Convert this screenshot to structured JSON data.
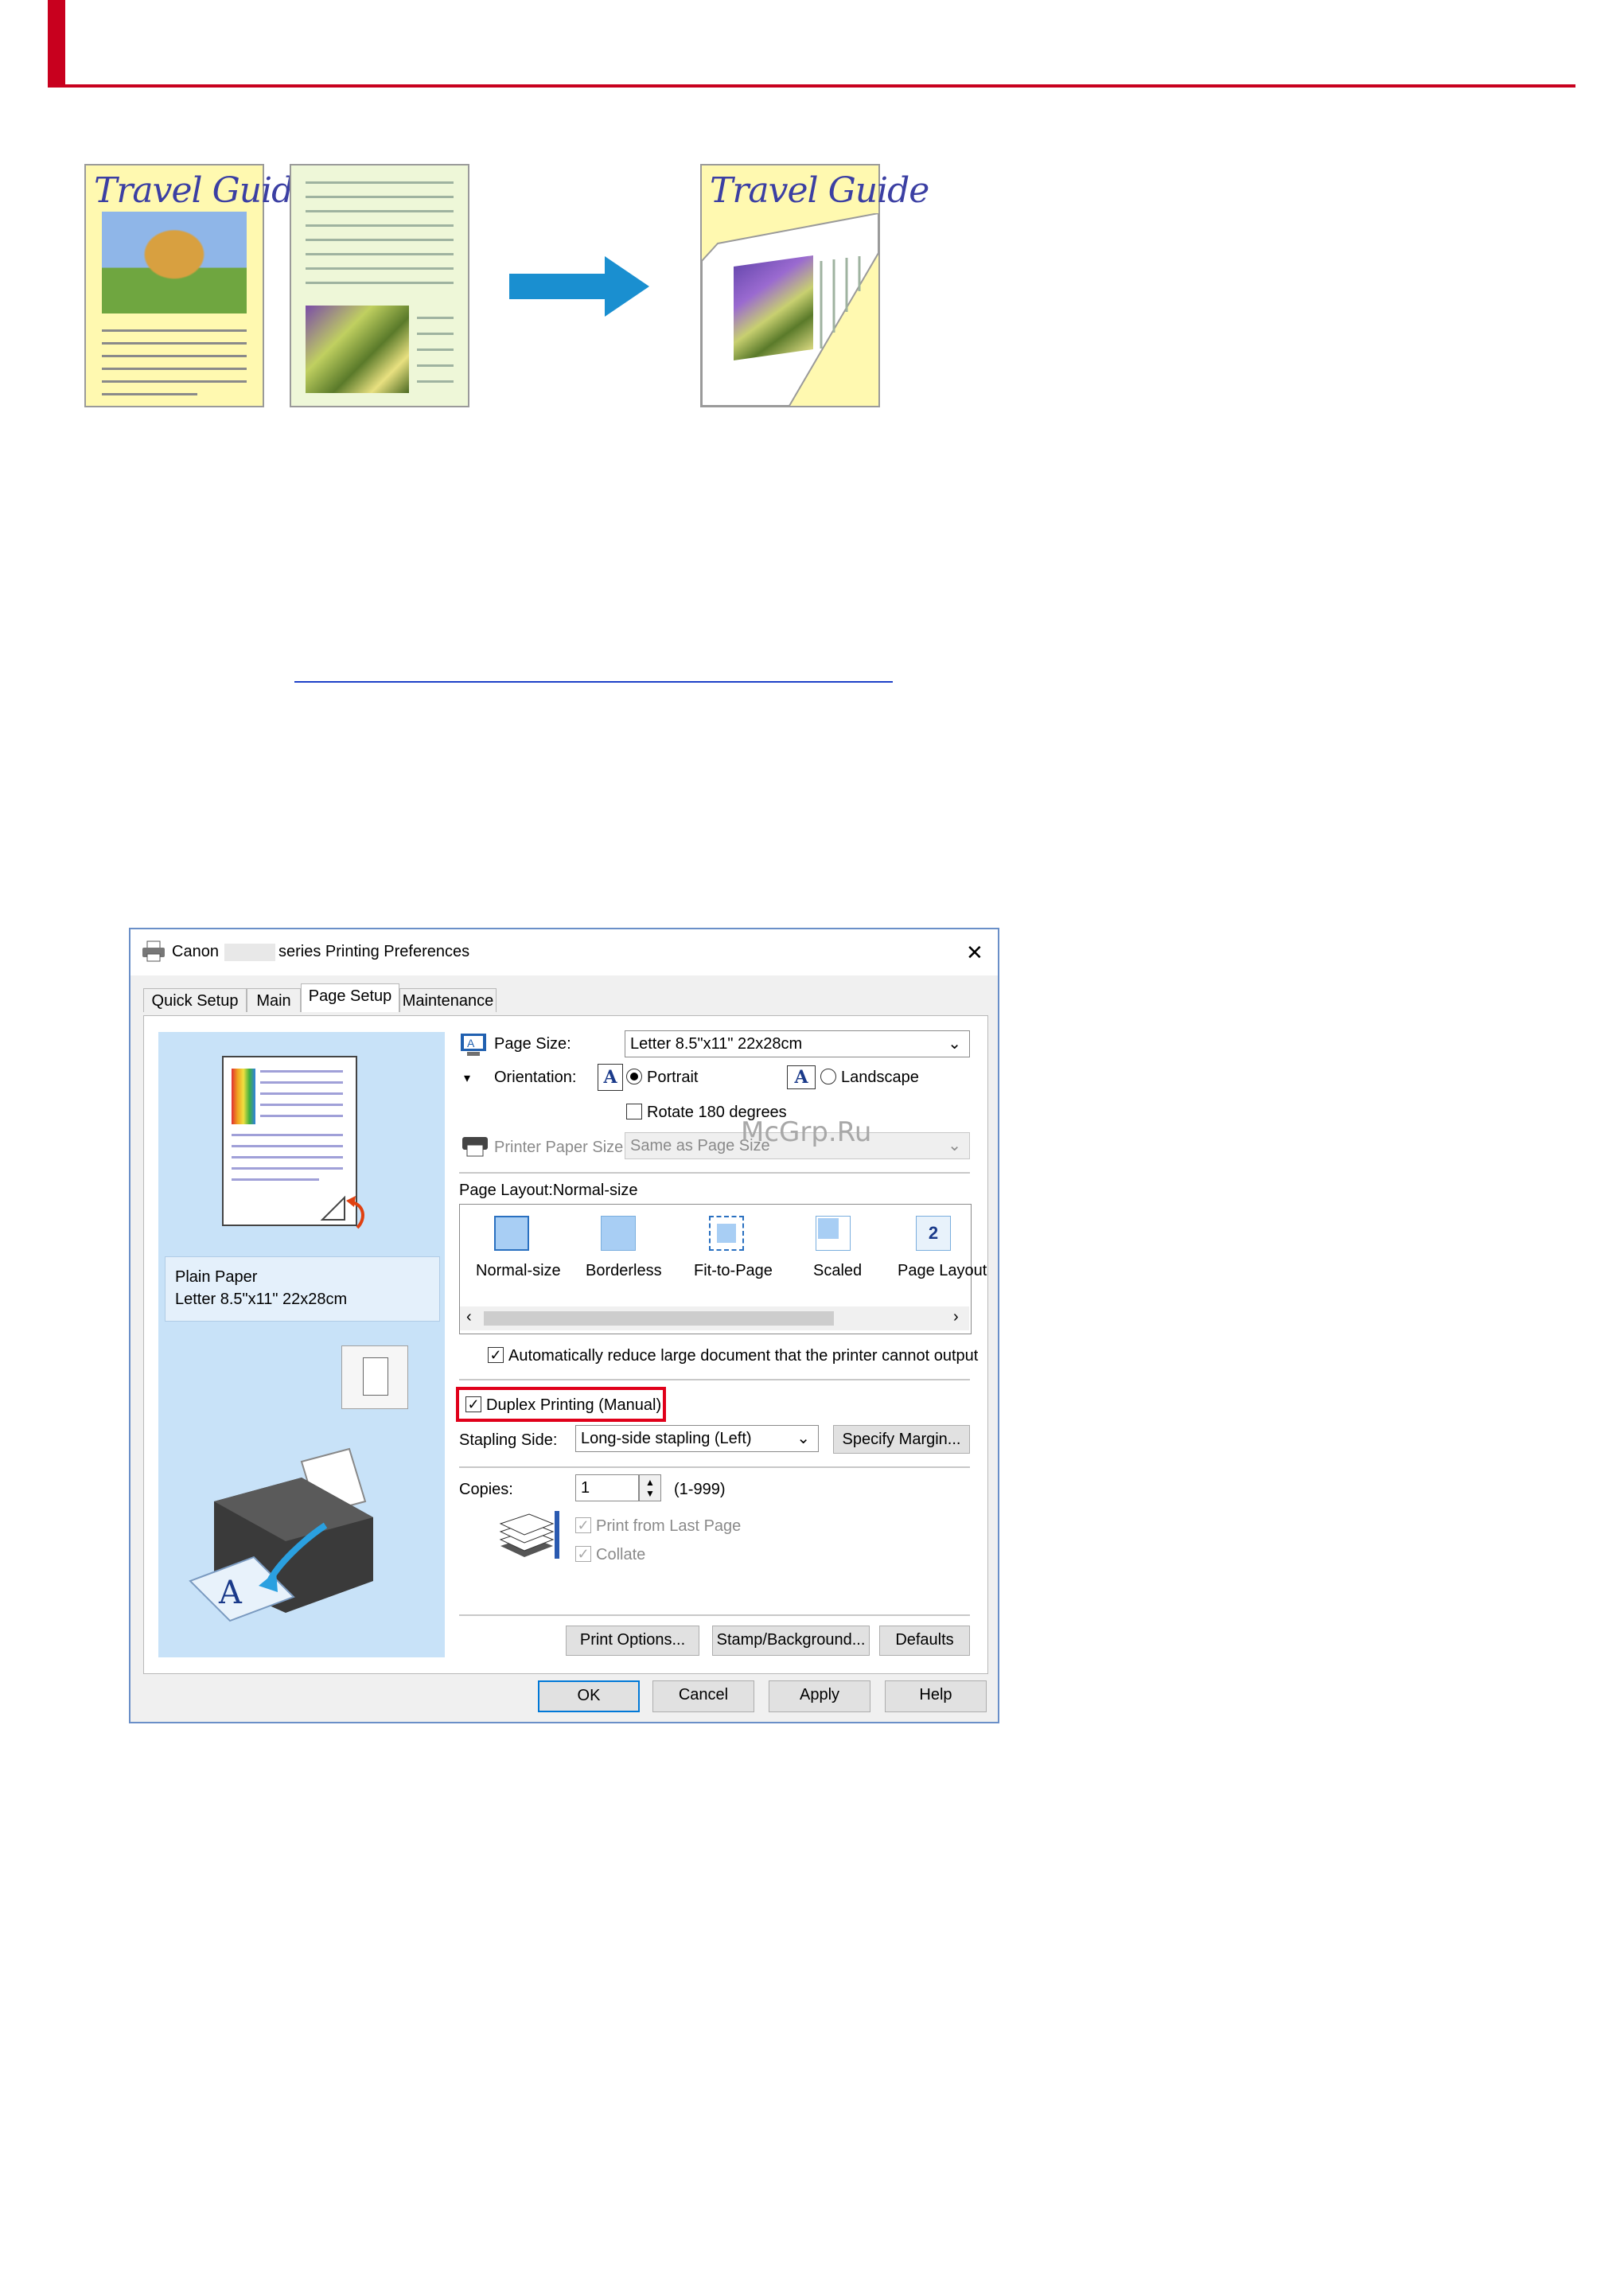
{
  "illustration": {
    "page1_title": "Travel Guide",
    "result_title": "Travel Guide"
  },
  "watermark": "McGrp.Ru",
  "dialog": {
    "title_prefix": "Canon",
    "title_suffix": "series Printing Preferences",
    "close_glyph": "✕",
    "tabs": [
      "Quick Setup",
      "Main",
      "Page Setup",
      "Maintenance"
    ],
    "active_tab": "Page Setup",
    "preview": {
      "media_type": "Plain Paper",
      "media_size": "Letter 8.5\"x11\" 22x28cm"
    },
    "page_size_label": "Page Size:",
    "page_size_value": "Letter 8.5\"x11\" 22x28cm",
    "orientation_label": "Orientation:",
    "portrait_label": "Portrait",
    "landscape_label": "Landscape",
    "rotate_label": "Rotate 180 degrees",
    "printer_paper_size_label": "Printer Paper Size:",
    "printer_paper_size_value": "Same as Page Size",
    "page_layout_label": "Page Layout:Normal-size",
    "layouts": [
      "Normal-size",
      "Borderless",
      "Fit-to-Page",
      "Scaled",
      "Page Layout"
    ],
    "page_layout_icon_number": "2",
    "auto_reduce_label": "Automatically reduce large document that the printer cannot output",
    "duplex_label": "Duplex Printing (Manual)",
    "stapling_side_label": "Stapling Side:",
    "stapling_side_value": "Long-side stapling (Left)",
    "specify_margin_label": "Specify Margin...",
    "copies_label": "Copies:",
    "copies_value": "1",
    "copies_range": "(1-999)",
    "print_from_last_label": "Print from Last Page",
    "collate_label": "Collate",
    "print_options_label": "Print Options...",
    "stamp_background_label": "Stamp/Background...",
    "defaults_label": "Defaults",
    "ok_label": "OK",
    "cancel_label": "Cancel",
    "apply_label": "Apply",
    "help_label": "Help"
  },
  "colors": {
    "accent_red": "#c8001e",
    "arrow_blue": "#1a8fd0",
    "dialog_border": "#6a8fc8",
    "highlight_box": "#e0001a"
  }
}
